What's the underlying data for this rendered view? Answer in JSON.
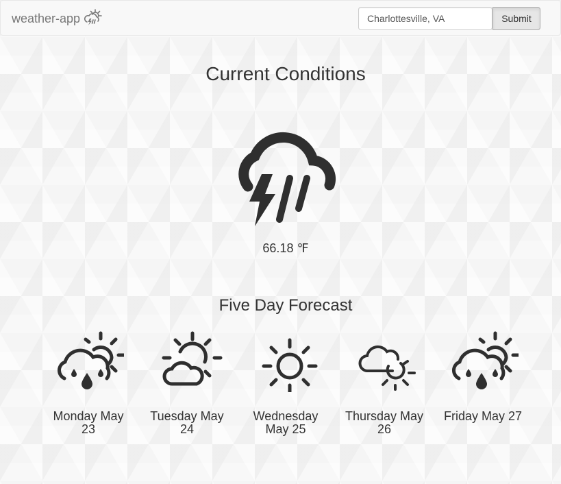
{
  "navbar": {
    "brand": "weather-app",
    "brand_icon": "thunder-cloud-sun-icon",
    "search": {
      "value": "Charlottesville, VA",
      "placeholder": ""
    },
    "submit_label": "Submit"
  },
  "current": {
    "title": "Current Conditions",
    "icon": "thunderstorm-rain-icon",
    "temperature": "66.18 ℉"
  },
  "forecast": {
    "title": "Five Day Forecast",
    "days": [
      {
        "label": "Monday May 23",
        "icon": "sun-cloud-rain-icon"
      },
      {
        "label": "Tuesday May 24",
        "icon": "sun-cloud-icon"
      },
      {
        "label": "Wednesday May 25",
        "icon": "sun-icon"
      },
      {
        "label": "Thursday May 26",
        "icon": "cloud-sun-icon"
      },
      {
        "label": "Friday May 27",
        "icon": "sun-cloud-rain-icon"
      }
    ]
  },
  "colors": {
    "icon": "#2f2f2f",
    "navbar_bg": "#f8f8f8",
    "text": "#333333"
  }
}
